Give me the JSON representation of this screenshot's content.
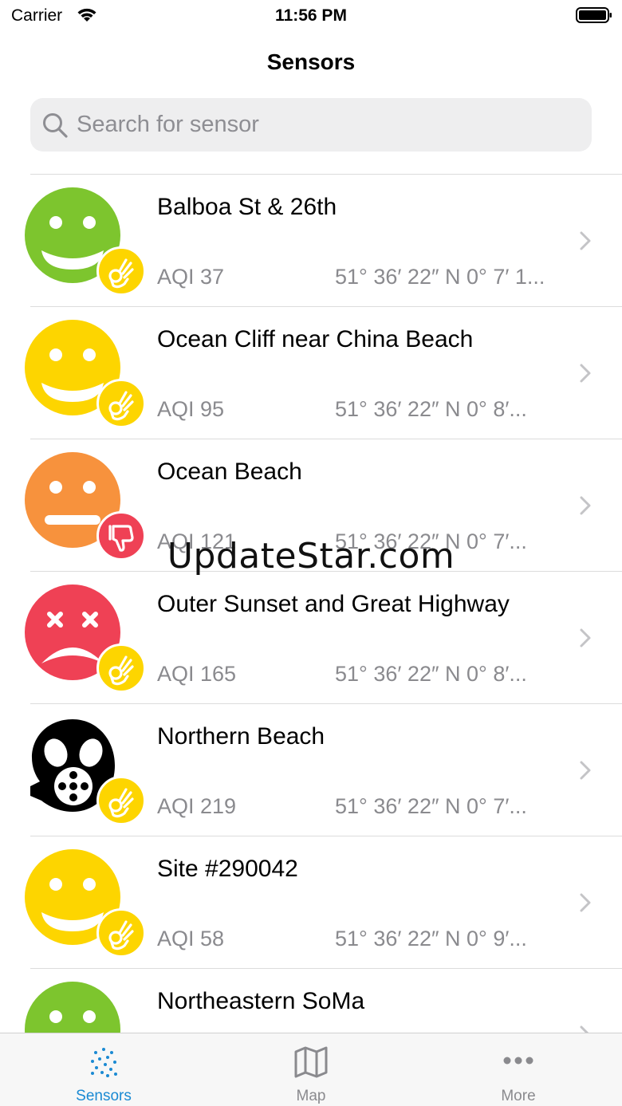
{
  "status_bar": {
    "carrier": "Carrier",
    "time": "11:56 PM"
  },
  "nav": {
    "title": "Sensors"
  },
  "search": {
    "placeholder": "Search for sensor",
    "value": ""
  },
  "sensors": [
    {
      "name": "Balboa St & 26th",
      "aqi": "AQI 37",
      "coords": "51° 36′ 22″ N 0° 7′ 1...",
      "face": "happy-face-icon",
      "face_color": "#7dc52e",
      "badge": "ok-hand-icon",
      "badge_color": "#fdd500"
    },
    {
      "name": "Ocean Cliff near China Beach",
      "aqi": "AQI 95",
      "coords": "51° 36′ 22″ N 0° 8′...",
      "face": "happy-face-icon",
      "face_color": "#fdd500",
      "badge": "ok-hand-icon",
      "badge_color": "#fdd500"
    },
    {
      "name": "Ocean Beach",
      "aqi": "AQI 121",
      "coords": "51° 36′ 22″ N 0° 7′...",
      "face": "neutral-face-icon",
      "face_color": "#f7923d",
      "badge": "thumbs-down-icon",
      "badge_color": "#ef4155"
    },
    {
      "name": "Outer Sunset and Great Highway",
      "aqi": "AQI 165",
      "coords": "51° 36′ 22″ N 0° 8′...",
      "face": "sick-face-icon",
      "face_color": "#ef4155",
      "badge": "ok-hand-icon",
      "badge_color": "#fdd500"
    },
    {
      "name": "Northern Beach",
      "aqi": "AQI 219",
      "coords": "51° 36′ 22″ N 0° 7′...",
      "face": "gas-mask-icon",
      "face_color": "#000000",
      "badge": "ok-hand-icon",
      "badge_color": "#fdd500"
    },
    {
      "name": "Site #290042",
      "aqi": "AQI 58",
      "coords": "51° 36′ 22″ N 0° 9′...",
      "face": "happy-face-icon",
      "face_color": "#fdd500",
      "badge": "ok-hand-icon",
      "badge_color": "#fdd500"
    },
    {
      "name": "Northeastern SoMa",
      "aqi": "",
      "coords": "",
      "face": "happy-face-icon",
      "face_color": "#7dc52e",
      "badge": "",
      "badge_color": ""
    }
  ],
  "watermark": "UpdateStar.com",
  "tabs": [
    {
      "label": "Sensors",
      "icon": "sensors-dots-icon",
      "active": true
    },
    {
      "label": "Map",
      "icon": "map-icon",
      "active": false
    },
    {
      "label": "More",
      "icon": "more-dots-icon",
      "active": false
    }
  ],
  "colors": {
    "accent": "#1b8ad3",
    "secondary_text": "#8a8a8e"
  }
}
